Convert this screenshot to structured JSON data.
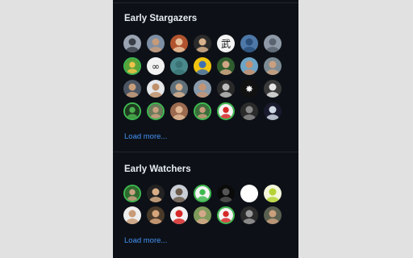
{
  "stargazers": {
    "title": "Early Stargazers",
    "load_more": "Load more...",
    "avatars": [
      {
        "bg": "#9aa4b2",
        "fg": "#3a3f47",
        "ring": false
      },
      {
        "bg": "#7d8ea3",
        "fg": "#c59b7a",
        "ring": false
      },
      {
        "bg": "#b0532e",
        "fg": "#e8c39e",
        "ring": false
      },
      {
        "bg": "#2b2b2b",
        "fg": "#d7b28b",
        "ring": false
      },
      {
        "bg": "#f4f4f4",
        "fg": "#111111",
        "ring": false,
        "glyph": "武"
      },
      {
        "bg": "#4d78a8",
        "fg": "#2c4f7a",
        "ring": false
      },
      {
        "bg": "#8f9aa8",
        "fg": "#596470",
        "ring": false
      },
      {
        "bg": "#5aa43a",
        "fg": "#f0c34a",
        "ring": true
      },
      {
        "bg": "#f2f2f2",
        "fg": "#222222",
        "ring": false,
        "glyph": "∞"
      },
      {
        "bg": "#4a8a8c",
        "fg": "#3b7375",
        "ring": false
      },
      {
        "bg": "#f1c40f",
        "fg": "#3f6fb0",
        "ring": false
      },
      {
        "bg": "#2f5d2e",
        "fg": "#d1a684",
        "ring": false
      },
      {
        "bg": "#6ea5c7",
        "fg": "#c88f6c",
        "ring": false
      },
      {
        "bg": "#7b8a93",
        "fg": "#caa080",
        "ring": false
      },
      {
        "bg": "#4b5563",
        "fg": "#c99e7a",
        "ring": false
      },
      {
        "bg": "#e5e7eb",
        "fg": "#c0906a",
        "ring": false
      },
      {
        "bg": "#5f6f7a",
        "fg": "#d6b08d",
        "ring": false
      },
      {
        "bg": "#8899aa",
        "fg": "#c49575",
        "ring": false
      },
      {
        "bg": "#2a2a2a",
        "fg": "#bdbdbd",
        "ring": false
      },
      {
        "bg": "#111111",
        "fg": "#f5f5f5",
        "ring": false,
        "glyph": "✸"
      },
      {
        "bg": "#3a3a3a",
        "fg": "#e5e5e5",
        "ring": false
      },
      {
        "bg": "#1f3a1f",
        "fg": "#4caf50",
        "ring": true
      },
      {
        "bg": "#6b7b5a",
        "fg": "#caa080",
        "ring": true
      },
      {
        "bg": "#9b6a4f",
        "fg": "#e0b896",
        "ring": false
      },
      {
        "bg": "#3b6e3a",
        "fg": "#c99b7a",
        "ring": true
      },
      {
        "bg": "#f5f5f5",
        "fg": "#d62828",
        "ring": true
      },
      {
        "bg": "#2b2b2b",
        "fg": "#8a8a8a",
        "ring": false
      },
      {
        "bg": "#1a1a2e",
        "fg": "#cfd8e3",
        "ring": false
      }
    ]
  },
  "watchers": {
    "title": "Early Watchers",
    "load_more": "Load more...",
    "avatars": [
      {
        "bg": "#2f6b2f",
        "fg": "#caa080",
        "ring": true
      },
      {
        "bg": "#222222",
        "fg": "#d9ae86",
        "ring": false
      },
      {
        "bg": "#c9ced6",
        "fg": "#6b5a4a",
        "ring": false
      },
      {
        "bg": "#f5f5f5",
        "fg": "#3fb950",
        "ring": true
      },
      {
        "bg": "#0a0a0a",
        "fg": "#555555",
        "ring": false
      },
      {
        "bg": "#ffffff",
        "fg": "#ffffff",
        "ring": false
      },
      {
        "bg": "#f4f7dc",
        "fg": "#b5d334",
        "ring": false
      },
      {
        "bg": "#eeeeee",
        "fg": "#c79b77",
        "ring": false
      },
      {
        "bg": "#4a3a2a",
        "fg": "#d6a57c",
        "ring": false
      },
      {
        "bg": "#f2f2f2",
        "fg": "#d62828",
        "ring": false
      },
      {
        "bg": "#7d9a5a",
        "fg": "#d4a88a",
        "ring": false
      },
      {
        "bg": "#f5f5f5",
        "fg": "#d62828",
        "ring": true
      },
      {
        "bg": "#2b2b2b",
        "fg": "#9a9a9a",
        "ring": false
      },
      {
        "bg": "#5a6050",
        "fg": "#c99f7c",
        "ring": false
      }
    ]
  }
}
